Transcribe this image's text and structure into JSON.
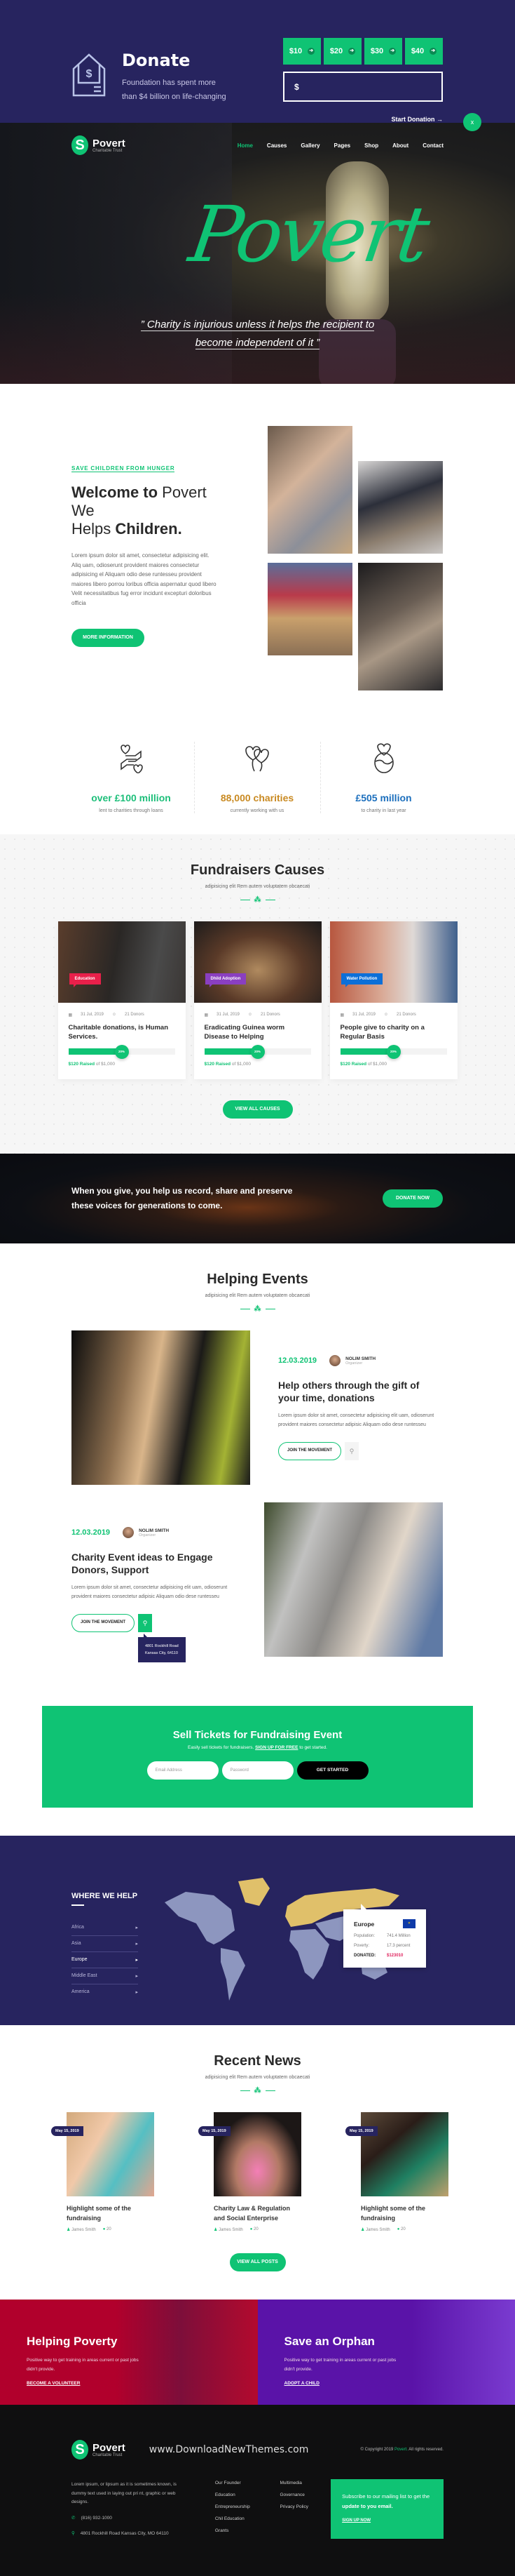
{
  "donate": {
    "title": "Donate",
    "subtitle": "Foundation has spent more than $4 billion on life-changing",
    "amounts": [
      "$10",
      "$20",
      "$30",
      "$40"
    ],
    "amount_prefix": "$",
    "start_label": "Start Donation →",
    "close_label": "x"
  },
  "nav": {
    "logo_name": "Povert",
    "logo_tagline": "Charitable Trust",
    "items": [
      "Home",
      "Causes",
      "Gallery",
      "Pages",
      "Shop",
      "About",
      "Contact"
    ],
    "active": "Home"
  },
  "hero": {
    "script_title": "Povert",
    "quote_line1": "” Charity is injurious unless it helps the recipient to",
    "quote_line2": "become independent of it ”"
  },
  "welcome": {
    "kicker": "SAVE CHILDREN FROM HUNGER",
    "title_bold1": "Welcome to",
    "title_light1": " Povert We",
    "title_light2": "Helps ",
    "title_bold2": "Children.",
    "body": "Lorem ipsum dolor sit amet, consectetur adipisicing elit. Aliq uam, odioserunt provident maiores consectetur adipisicing el Aliquam odio dese runtesseu provident maiores libero porrou loribus officia aspernatur quod libero Velit necessitatibus fug error incidunt excepturi doloribus officia",
    "button": "MORE INFORMATION",
    "photos": [
      "Volunteers",
      "Giving money",
      "Homeless sign",
      "Elderly man"
    ]
  },
  "stats": [
    {
      "icon": "hands-hearts-icon",
      "value": "over £100 million",
      "label": "lent to charities through loans",
      "color": "#1dbf7a"
    },
    {
      "icon": "balloons-icon",
      "value": "88,000 charities",
      "label": "currently working with us",
      "color": "#c98a22"
    },
    {
      "icon": "globe-heart-icon",
      "value": "£505 million",
      "label": "to charity in last year",
      "color": "#1c6fbd"
    }
  ],
  "causes": {
    "title": "Fundraisers Causes",
    "subtitle": "adipisicing elit Rem autem voluptatem obcaecati",
    "button": "VIEW ALL CAUSES",
    "items": [
      {
        "tag": "Education",
        "tag_color": "#e8204a",
        "date": "31 Jul, 2019",
        "donors": "21 Donors",
        "title": "Charitable donations, is Human Services.",
        "progress": 20,
        "progress_label": "20%",
        "raised": "$120 Raised",
        "goal": "of $1,000"
      },
      {
        "tag": "Dhild Adoption",
        "tag_color": "#8a3fc0",
        "date": "31 Jul, 2019",
        "donors": "21 Donors",
        "title": "Eradicating Guinea worm Disease to Helping",
        "progress": 20,
        "progress_label": "20%",
        "raised": "$120 Raised",
        "goal": "of $1,000"
      },
      {
        "tag": "Water Pollution",
        "tag_color": "#0c6fd8",
        "date": "31 Jul, 2019",
        "donors": "21 Donors",
        "title": "People give to charity on a Regular Basis",
        "progress": 20,
        "progress_label": "20%",
        "raised": "$120 Raised",
        "goal": "of $1,000"
      }
    ]
  },
  "cta": {
    "text": "When you give, you help us record, share and preserve these voices for generations to come.",
    "button": "DONATE NOW"
  },
  "events": {
    "title": "Helping Events",
    "subtitle": "adipisicing elit Rem autem voluptatem obcaecati",
    "items": [
      {
        "date": "12.03.2019",
        "organizer": "NOLIM SMITH",
        "role": "Organizer",
        "title": "Help others through the gift of your time, donations",
        "body": "Lorem ipsum dolor sit amet, consectetur adipisicing elit uam, odioserunt provident maiores consectetur adipisic Aliquam odio dese runtesseu",
        "button": "JOIN THE MOVEMENT"
      },
      {
        "date": "12.03.2019",
        "organizer": "NOLIM SMITH",
        "role": "Organizer",
        "title": "Charity Event ideas to Engage Donors, Support",
        "body": "Lorem ipsum dolor sit amet, consectetur adipisicing elit uam, odioserunt provident maiores consectetur adipisic Aliquam odio dese runtesseu",
        "button": "JOIN THE MOVEMENT",
        "address_line1": "4801 Rockhill Road",
        "address_line2": "Kansas City, 64110"
      }
    ]
  },
  "tickets": {
    "title": "Sell Tickets for Fundraising Event",
    "text_before": "Easily sell tickets for fundraisers. ",
    "link": "SIGN UP FOR FREE",
    "text_after": " to get started.",
    "email_placeholder": "Email Address",
    "password_placeholder": "Password",
    "button": "GET STARTED"
  },
  "where": {
    "title": "WHERE WE HELP",
    "regions": [
      "Africa",
      "Asia",
      "Europe",
      "Middle East",
      "America"
    ],
    "active": "Europe",
    "tooltip": {
      "region": "Europe",
      "population_label": "Population:",
      "population": "741.4 Million",
      "poverty_label": "Poverty:",
      "poverty": "17.3 percent",
      "donated_label": "DONATED:",
      "donated": "$123010"
    }
  },
  "news": {
    "title": "Recent News",
    "subtitle": "adipisicing elit Rem autem voluptatem obcaecati",
    "button": "VIEW ALL POSTS",
    "posts": [
      {
        "date": "May 15, 2019",
        "title": "Highlight some of the fundraising",
        "author": "James Smith",
        "comments": "20"
      },
      {
        "date": "May 15, 2019",
        "title": "Charity Law & Regulation and Social Enterprise",
        "author": "James Smith",
        "comments": "20"
      },
      {
        "date": "May 15, 2019",
        "title": "Highlight some of the fundraising",
        "author": "James Smith",
        "comments": "20"
      }
    ]
  },
  "split": [
    {
      "title": "Helping Poverty",
      "text": "Positive way to get training in areas current or past jobs didn't provide.",
      "link": "BECOME A VOLUNTEER"
    },
    {
      "title": "Save an Orphan",
      "text": "Positive way to get training in areas current or past jobs didn't provide.",
      "link": "ADOPT A CHILD"
    }
  ],
  "footer": {
    "logo_name": "Povert",
    "logo_tagline": "Charitable Trust",
    "watermark": "www.DownloadNewThemes.com",
    "copyright_before": "© Copyright 2019 ",
    "copyright_brand": "Povert.",
    "copyright_after": " All rights reserved.",
    "about": "Lorem ipsum, or lipsum as it is sometimes known, is dummy text used in laying out pri nt, graphic or web designs.",
    "phone": "(816) 932-1000",
    "address": "4801 Rockhill Road Kansas City, MO 64110",
    "links_col1": [
      "Our Founder",
      "Education",
      "Entrepreneurship",
      "Chil Education",
      "Grants"
    ],
    "links_col2": [
      "Multimedia",
      "Governance",
      "Privacy Policy"
    ],
    "subscribe_text": "Subscribe to our mailing list to get the ",
    "subscribe_bold": "update to you email.",
    "subscribe_link": "SIGN UP NOW"
  }
}
